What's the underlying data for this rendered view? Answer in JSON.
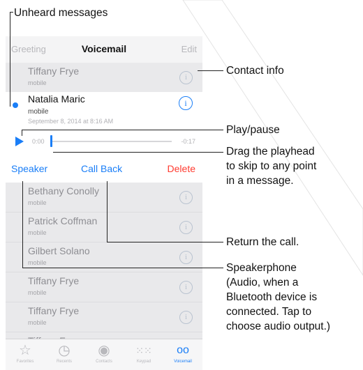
{
  "navbar": {
    "left": "Greeting",
    "title": "Voicemail",
    "right": "Edit"
  },
  "rows_top": [
    {
      "name": "Tiffany Frye",
      "sub": "mobile"
    }
  ],
  "active": {
    "name": "Natalia Maric",
    "sub": "mobile",
    "date": "September 8, 2014 at 8:16 AM",
    "time_start": "0:00",
    "time_end": "-0:17",
    "speaker": "Speaker",
    "callback": "Call Back",
    "delete": "Delete"
  },
  "rows_bottom": [
    {
      "name": "Bethany Conolly",
      "sub": "mobile"
    },
    {
      "name": "Patrick Coffman",
      "sub": "mobile"
    },
    {
      "name": "Gilbert Solano",
      "sub": "mobile"
    },
    {
      "name": "Tiffany Frye",
      "sub": "mobile"
    },
    {
      "name": "Tiffany Frye",
      "sub": "mobile"
    },
    {
      "name": "Tiffany Frye",
      "sub": ""
    }
  ],
  "tabs": [
    {
      "label": "Favorites",
      "icon": "star-icon"
    },
    {
      "label": "Recents",
      "icon": "clock-icon"
    },
    {
      "label": "Contacts",
      "icon": "person-icon"
    },
    {
      "label": "Keypad",
      "icon": "keypad-icon"
    },
    {
      "label": "Voicemail",
      "icon": "voicemail-icon",
      "active": true
    }
  ],
  "callouts": {
    "unheard": "Unheard messages",
    "contact_info": "Contact info",
    "play_pause": "Play/pause",
    "drag": [
      "Drag the playhead",
      "to skip to any point",
      "in a message."
    ],
    "return_call": "Return the call.",
    "speakerphone": [
      "Speakerphone",
      "(Audio, when a",
      "Bluetooth device is",
      "connected. Tap to",
      "choose audio output.)"
    ]
  },
  "colors": {
    "accent": "#1a7ef7",
    "delete": "#ff3b30"
  }
}
